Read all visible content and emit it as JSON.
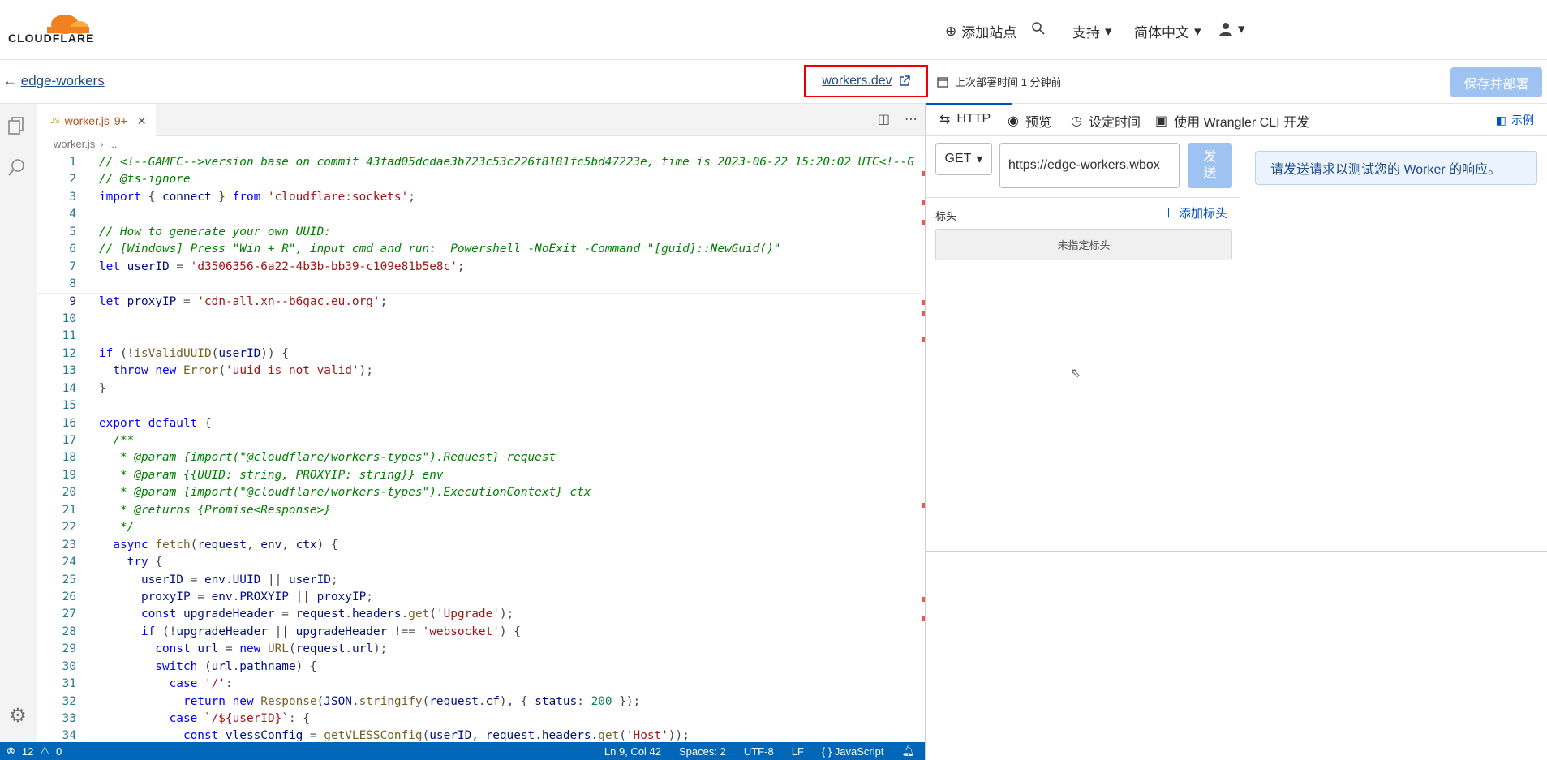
{
  "header": {
    "logo_text": "CLOUDFLARE",
    "add_site": "添加站点",
    "support": "支持",
    "language": "简体中文"
  },
  "subbar": {
    "back_label": "edge-workers",
    "workers_dev": "workers.dev",
    "last_deploy": "上次部署时间 1 分钟前",
    "save_deploy": "保存并部署"
  },
  "editor": {
    "tab_label": "worker.js",
    "tab_badge": "9+",
    "tab_type": "JS",
    "breadcrumb_file": "worker.js",
    "breadcrumb_more": "...",
    "current_line": 9,
    "lines": [
      "// <!--GAMFC-->version base on commit 43fad05dcdae3b723c53c226f8181fc5bd47223e, time is 2023-06-22 15:20:02 UTC<!--G",
      "// @ts-ignore",
      "import { connect } from 'cloudflare:sockets';",
      "",
      "// How to generate your own UUID:",
      "// [Windows] Press \"Win + R\", input cmd and run:  Powershell -NoExit -Command \"[guid]::NewGuid()\"",
      "let userID = 'd3506356-6a22-4b3b-bb39-c109e81b5e8c';",
      "",
      "let proxyIP = 'cdn-all.xn--b6gac.eu.org';",
      "",
      "",
      "if (!isValidUUID(userID)) {",
      "  throw new Error('uuid is not valid');",
      "}",
      "",
      "export default {",
      "  /**",
      "   * @param {import(\"@cloudflare/workers-types\").Request} request",
      "   * @param {{UUID: string, PROXYIP: string}} env",
      "   * @param {import(\"@cloudflare/workers-types\").ExecutionContext} ctx",
      "   * @returns {Promise<Response>}",
      "   */",
      "  async fetch(request, env, ctx) {",
      "    try {",
      "      userID = env.UUID || userID;",
      "      proxyIP = env.PROXYIP || proxyIP;",
      "      const upgradeHeader = request.headers.get('Upgrade');",
      "      if (!upgradeHeader || upgradeHeader !== 'websocket') {",
      "        const url = new URL(request.url);",
      "        switch (url.pathname) {",
      "          case '/':",
      "            return new Response(JSON.stringify(request.cf), { status: 200 });",
      "          case `/${userID}`: {",
      "            const vlessConfig = getVLESSConfig(userID, request.headers.get('Host'));"
    ]
  },
  "statusbar": {
    "errors": "12",
    "warnings": "0",
    "position": "Ln 9, Col 42",
    "spaces": "Spaces: 2",
    "encoding": "UTF-8",
    "eol": "LF",
    "language": "JavaScript"
  },
  "panel": {
    "tabs": [
      "HTTP",
      "预览",
      "设定时间",
      "使用 Wrangler CLI 开发"
    ],
    "examples": "示例",
    "method": "GET",
    "url": "https://edge-workers.wbox",
    "send": "发送",
    "headers_label": "标头",
    "add_header": "添加标头",
    "no_headers": "未指定标头",
    "hint": "请发送请求以测试您的 Worker 的响应。"
  },
  "colors": {
    "accent": "#0051c3",
    "cf_orange": "#f38020",
    "statusbar": "#0066b8",
    "highlight_border": "#e00000"
  }
}
